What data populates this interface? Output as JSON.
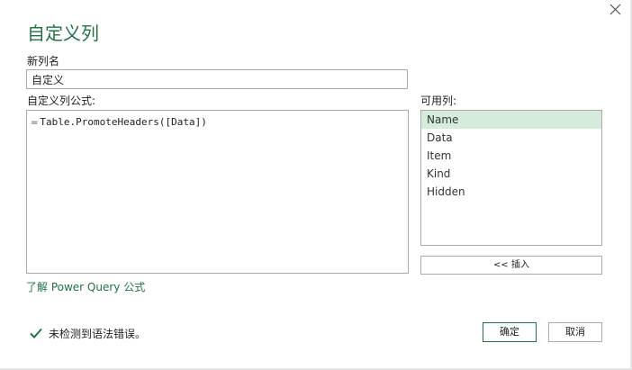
{
  "dialog": {
    "title": "自定义列",
    "close_icon": "close-icon"
  },
  "new_column": {
    "label": "新列名",
    "value": "自定义"
  },
  "formula": {
    "label": "自定义列公式:",
    "prefix": "=",
    "text": "Table.PromoteHeaders([Data])"
  },
  "available_columns": {
    "label": "可用列:",
    "items": [
      "Name",
      "Data",
      "Item",
      "Kind",
      "Hidden"
    ],
    "selected": "Name"
  },
  "insert_button": "<< 插入",
  "learn_link": "了解 Power Query 公式",
  "status": {
    "icon": "checkmark-icon",
    "text": "未检测到语法错误。"
  },
  "buttons": {
    "ok": "确定",
    "cancel": "取消"
  },
  "colors": {
    "accent": "#217346",
    "selected_row": "#d5ecdd",
    "border": "#ababab"
  }
}
